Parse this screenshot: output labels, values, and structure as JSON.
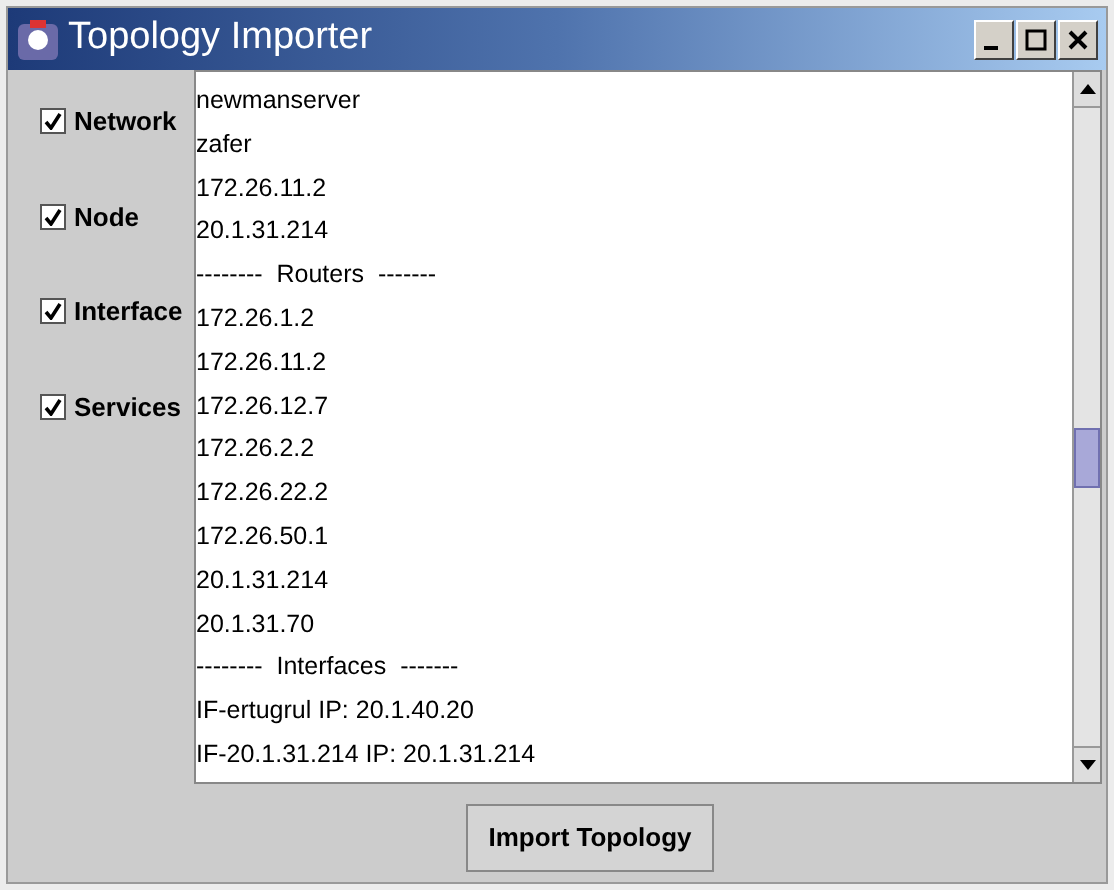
{
  "window": {
    "title": "Topology Importer"
  },
  "options": [
    {
      "label": "Network",
      "checked": true
    },
    {
      "label": "Node",
      "checked": true
    },
    {
      "label": "Interface",
      "checked": true
    },
    {
      "label": "Services",
      "checked": true
    }
  ],
  "output_lines": [
    "newmanserver",
    "zafer",
    "172.26.11.2",
    "20.1.31.214",
    "--------  Routers  -------",
    "172.26.1.2",
    "172.26.11.2",
    "172.26.12.7",
    "172.26.2.2",
    "172.26.22.2",
    "172.26.50.1",
    "20.1.31.214",
    "20.1.31.70",
    "--------  Interfaces  -------",
    "IF-ertugrul IP: 20.1.40.20",
    "IF-20.1.31.214 IP: 20.1.31.214"
  ],
  "buttons": [
    "Import Topology"
  ]
}
